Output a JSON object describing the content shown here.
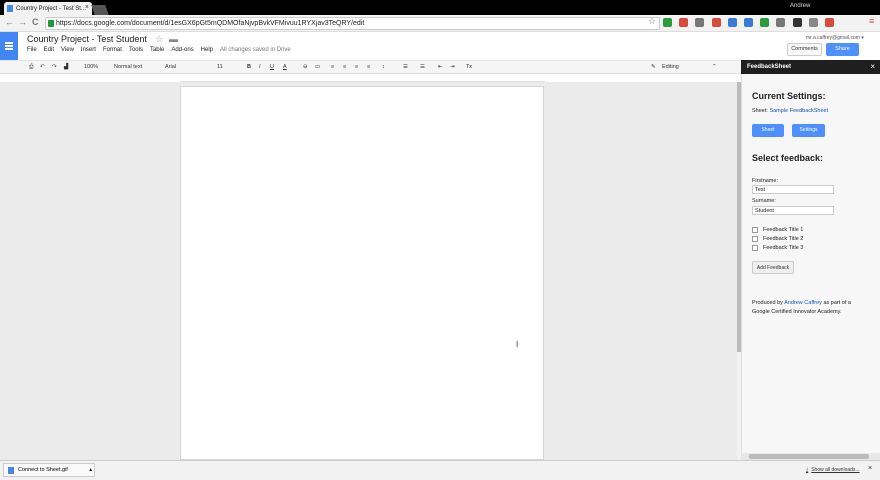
{
  "browser": {
    "tab_title": "Country Project - Test St...",
    "tab_close": "×",
    "user": "Andrew",
    "url": "https://docs.google.com/document/d/1esGX6pGt5mQDMOfaNjvpBvkVFMivuu1RYXjav3TeQRY/edit",
    "nav": {
      "back": "←",
      "forward": "→",
      "reload": "C"
    },
    "star": "☆",
    "menu_icon": "≡",
    "ext_colors": [
      "#2a9d3a",
      "#d64b3a",
      "#777",
      "#d64b3a",
      "#3a7bd5",
      "#3a7bd5",
      "#2a9d3a",
      "#777",
      "#333",
      "#888",
      "#d64b3a"
    ]
  },
  "doc": {
    "title": "Country Project - Test Student",
    "star": "☆",
    "folder": "▬",
    "menu": [
      "File",
      "Edit",
      "View",
      "Insert",
      "Format",
      "Tools",
      "Table",
      "Add-ons",
      "Help"
    ],
    "saved_status": "All changes saved in Drive",
    "account": "mr.a.caffrey@gmail.com ▾",
    "comments": "Comments",
    "share": "Share"
  },
  "toolbar": {
    "print": "⎙",
    "undo": "↶",
    "redo": "↷",
    "paint": "▟",
    "zoom": "100%",
    "style": "Normal text",
    "font": "Arial",
    "size": "11",
    "bold": "B",
    "italic": "I",
    "underline": "U",
    "color": "A",
    "link": "⊖",
    "comment": "▭",
    "align": [
      "≡",
      "≡",
      "≡",
      "≡"
    ],
    "spacing": "↕",
    "lists": [
      "☰",
      "☰"
    ],
    "indent": [
      "⇤",
      "⇥"
    ],
    "clear": "Tx",
    "mode": "Editing",
    "collapse": "⌃"
  },
  "panel": {
    "title": "FeedbackSheet",
    "close": "×",
    "current_heading": "Current Settings:",
    "sheet_label": "Sheet:",
    "sheet_name": "Sample FeedbackSheet",
    "btn_sheet": "Sheet",
    "btn_settings": "Settings",
    "select_heading": "Select feedback:",
    "firstname_label": "Firstname:",
    "firstname_value": "Test",
    "surname_label": "Surname:",
    "surname_value": "Student",
    "options": [
      "Feedback Title 1",
      "Feedback Title 2",
      "Feedback Title 3"
    ],
    "add_btn": "Add Feedback",
    "produced_pre": "Produced by",
    "produced_name": "Andrew Caffrey",
    "produced_post": "as part of a",
    "produced_line2": "Google Certified Innovator Academy."
  },
  "downloads": {
    "file": "Connect to Sheet.gif",
    "show_all": "Show all downloads...",
    "close": "×"
  }
}
